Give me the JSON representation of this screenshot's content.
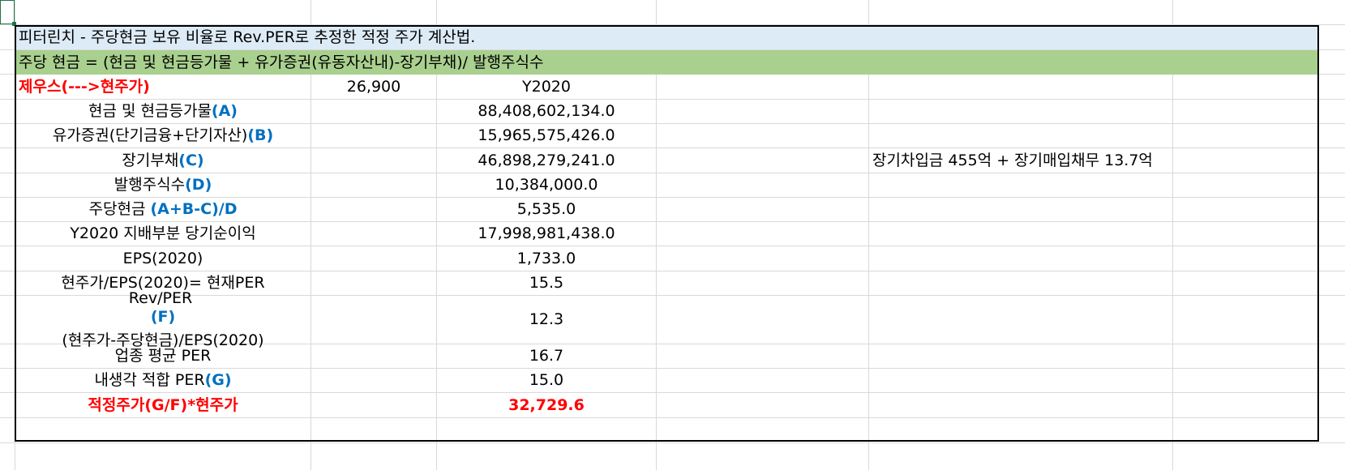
{
  "sheet": {
    "title_row": "피터린치 - 주당현금 보유 비율로 Rev.PER로 추정한 적정 주가 계산법.",
    "formula_row": "주당 현금 = (현금 및 현금등가물 + 유가증권(유동자산내)-장기부채)/ 발행주식수",
    "company": {
      "label": "제우스(--->현주가)",
      "price": "26,900",
      "year": "Y2020"
    },
    "rows": [
      {
        "label": "현금 및 현금등가물",
        "tag": "(A)",
        "value": "88,408,602,134.0"
      },
      {
        "label": "유가증권(단기금융+단기자산)",
        "tag": "(B)",
        "value": "15,965,575,426.0"
      },
      {
        "label": "장기부채",
        "tag": "(C)",
        "value": "46,898,279,241.0",
        "note": "장기차입금 455억 + 장기매입채무 13.7억"
      },
      {
        "label": "발행주식수",
        "tag": "(D)",
        "value": "10,384,000.0"
      },
      {
        "label": "주당현금 ",
        "tag": "(A+B-C)/D",
        "value": "5,535.0"
      },
      {
        "label": "Y2020 지배부분 당기순이익",
        "tag": "",
        "value": "17,998,981,438.0"
      },
      {
        "label": "EPS(2020)",
        "tag": "",
        "value": "1,733.0"
      },
      {
        "label": "현주가/EPS(2020)= 현재PER",
        "tag": "",
        "value": "15.5"
      }
    ],
    "rev_per": {
      "line1": "Rev/PER ",
      "tag": "(F)",
      "line2": "(현주가-주당현금)/EPS(2020)",
      "value": "12.3"
    },
    "industry_per": {
      "label": "업종 평균 PER",
      "value": "16.7"
    },
    "my_per": {
      "label": "내생각 적합 PER",
      "tag": "(G)",
      "value": "15.0"
    },
    "fair_price": {
      "label": "적정주가(G/F)*현주가",
      "value": "32,729.6"
    }
  },
  "colors": {
    "title_fill": "#ddebf7",
    "formula_fill": "#a9d08e",
    "accent_red": "#ff0000",
    "accent_blue": "#0070c0",
    "grid": "#d9d9d9"
  }
}
